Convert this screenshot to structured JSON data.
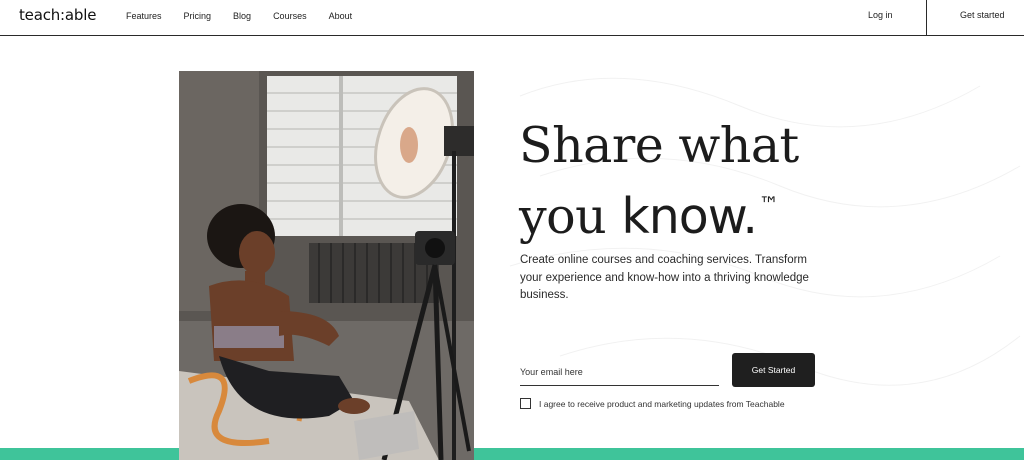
{
  "header": {
    "logo": "teach:able",
    "nav": [
      {
        "label": "Features"
      },
      {
        "label": "Pricing"
      },
      {
        "label": "Blog"
      },
      {
        "label": "Courses"
      },
      {
        "label": "About"
      }
    ],
    "login": "Log in",
    "get_started": "Get started"
  },
  "hero": {
    "headline_line1": "Share what",
    "headline_line2_a": "you ",
    "headline_line2_b": "know.",
    "trademark": "™",
    "description": "Create online courses and coaching services. Transform your experience and know-how into a thriving knowledge business.",
    "email_placeholder": "Your email here",
    "submit_label": "Get Started",
    "consent_label": "I agree to receive product and marketing updates from Teachable"
  },
  "colors": {
    "accent_band": "#3fc49a",
    "button_bg": "#1f1f1f",
    "text": "#1c1c1c"
  }
}
